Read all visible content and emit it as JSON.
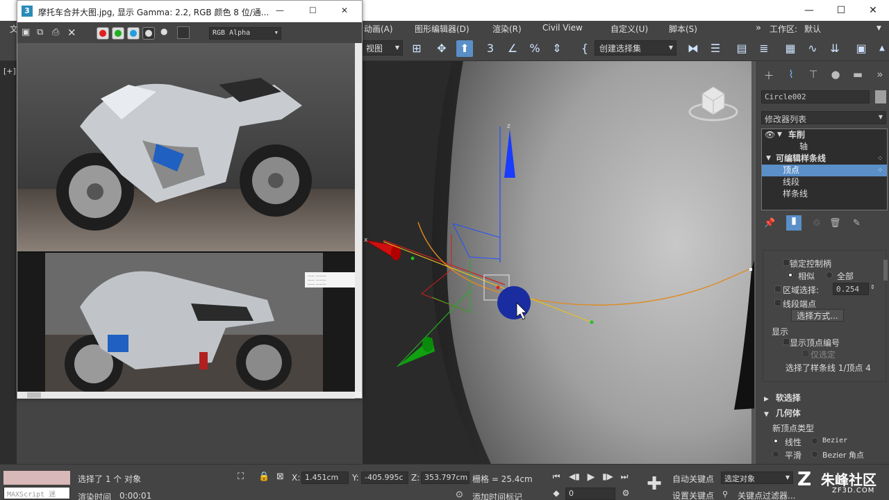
{
  "app_window": {
    "menu": [
      "动画(A)",
      "图形编辑器(D)",
      "渲染(R)",
      "Civil View",
      "自定义(U)",
      "脚本(S)"
    ],
    "menu_partial_left": "文",
    "workspace_label": "工作区:",
    "workspace_value": "默认",
    "more_icon": "double-chevron-right",
    "minimize": "—",
    "maximize": "☐",
    "close": "✕"
  },
  "toolbar": {
    "view_dropdown": "视图",
    "selection_set": "创建选择集"
  },
  "image_window": {
    "app_icon": "3",
    "title": "摩托车合并大图.jpg, 显示 Gamma: 2.2, RGB 颜色 8 位/通...",
    "channel": "RGB Alpha",
    "minimize": "—",
    "maximize": "☐",
    "close": "✕",
    "small_text_block": [
      "——  ———",
      "——  ———",
      "——  ———"
    ]
  },
  "viewport": {
    "label": "[+]",
    "axis_label_x": "x",
    "axis_label_z": "z"
  },
  "command_panel": {
    "object_name": "Circle002",
    "modifier_list": "修改器列表",
    "stack": {
      "lathe": "车削",
      "axis": "轴",
      "editable_spline": "可编辑样条线",
      "vertex": "顶点",
      "segment": "线段",
      "spline": "样条线"
    },
    "selection": {
      "lock_handles": "锁定控制柄",
      "alike": "相似",
      "all": "全部",
      "area_select": "区域选择:",
      "area_value": "0.254",
      "segment_end": "线段端点",
      "select_by": "选择方式...",
      "display": "显示",
      "show_vertex_numbers": "显示顶点编号",
      "selected_only": "仅选定",
      "status": "选择了样条线 1/顶点 4"
    },
    "soft_selection": "软选择",
    "geometry": "几何体",
    "new_vertex_type": "新顶点类型",
    "linear": "线性",
    "bezier": "Bezier",
    "smooth": "平滑",
    "bezier_corner": "Bezier 角点"
  },
  "status_bar": {
    "maxscript": "MAXScript 迷",
    "selected": "选择了 1 个 对象",
    "render_time_label": "渲染时间",
    "render_time": "0:00:01",
    "x_label": "X:",
    "x_value": "1.451cm",
    "y_label": "Y:",
    "y_value": "-405.995c",
    "z_label": "Z:",
    "z_value": "353.797cm",
    "grid": "栅格 = 25.4cm",
    "add_time_tag": "添加时间标记",
    "frame": "0",
    "auto_key": "自动关键点",
    "set_key": "设置关键点",
    "selected_object": "选定对象",
    "key_filters": "关键点过滤器...",
    "watermark": "朱峰社区",
    "watermark_url": "ZF3D.COM",
    "colors": {
      "swatch": "#d8b8b8"
    }
  }
}
